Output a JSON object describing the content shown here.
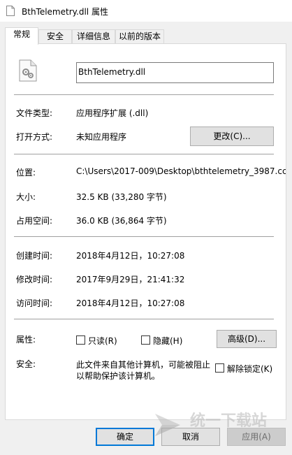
{
  "window": {
    "title": "BthTelemetry.dll 属性"
  },
  "tabs": [
    {
      "label": "常规"
    },
    {
      "label": "安全"
    },
    {
      "label": "详细信息"
    },
    {
      "label": "以前的版本"
    }
  ],
  "general": {
    "file_name": "BthTelemetry.dll",
    "file_type_label": "文件类型:",
    "file_type_value": "应用程序扩展 (.dll)",
    "open_with_label": "打开方式:",
    "open_with_value": "未知应用程序",
    "change_button": "更改(C)...",
    "location_label": "位置:",
    "location_value": "C:\\Users\\2017-009\\Desktop\\bthtelemetry_3987.cc",
    "size_label": "大小:",
    "size_value": "32.5 KB (33,280 字节)",
    "disk_size_label": "占用空间:",
    "disk_size_value": "36.0 KB (36,864 字节)",
    "created_label": "创建时间:",
    "created_value": "2018年4月12日，10:27:08",
    "modified_label": "修改时间:",
    "modified_value": "2017年9月29日，21:41:32",
    "accessed_label": "访问时间:",
    "accessed_value": "2018年4月12日，10:27:08",
    "attributes_label": "属性:",
    "readonly_label": "只读(R)",
    "hidden_label": "隐藏(H)",
    "advanced_button": "高级(D)...",
    "security_label": "安全:",
    "security_text_line1": "此文件来自其他计算机，可能被阻止",
    "security_text_line2": "以帮助保护该计算机。",
    "unblock_label": "解除锁定(K)"
  },
  "footer": {
    "ok_button": "确定",
    "cancel_button": "取消",
    "apply_button": "应用(A)"
  },
  "watermark": {
    "text": "统一下载站"
  },
  "colors": {
    "accent": "#0078d7",
    "panel": "#ffffff",
    "dialog_bg": "#f0f0f0"
  }
}
